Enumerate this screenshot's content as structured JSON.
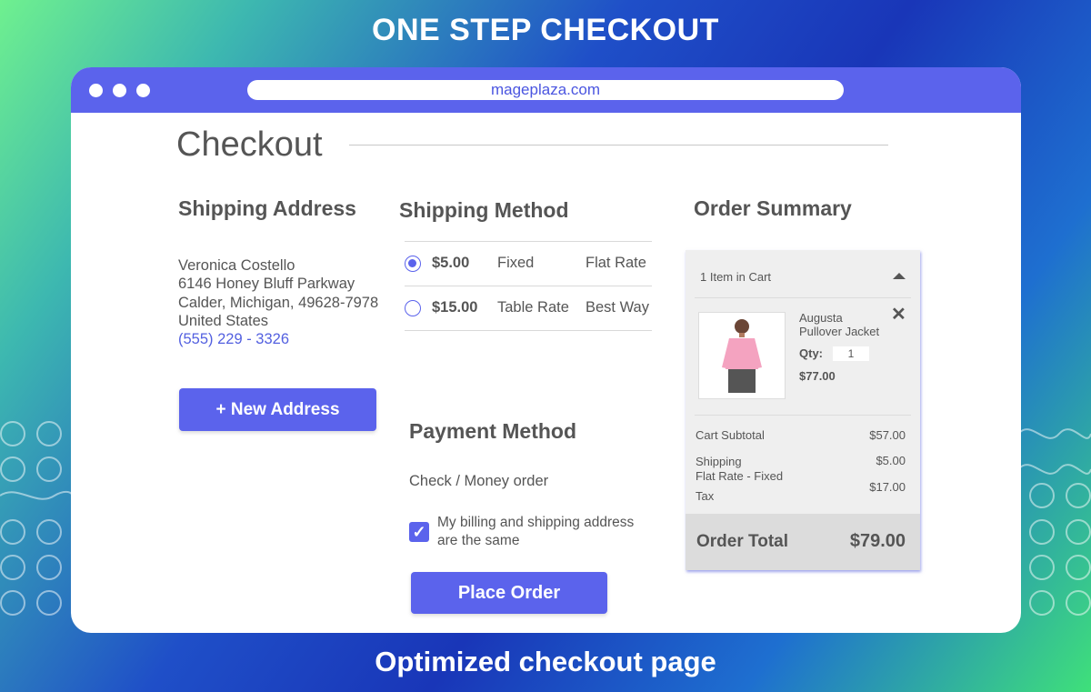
{
  "banner": {
    "headline": "ONE STEP CHECKOUT",
    "footline": "Optimized checkout page"
  },
  "browser": {
    "url": "mageplaza.com"
  },
  "checkout": {
    "title": "Checkout",
    "shipping_address": {
      "heading": "Shipping Address",
      "name": "Veronica Costello",
      "street": "6146 Honey Bluff Parkway",
      "city_line": "Calder, Michigan, 49628-7978",
      "country": "United States",
      "phone": "(555) 229 - 3326",
      "new_address_label": "+ New Address"
    },
    "shipping_method": {
      "heading": "Shipping Method",
      "options": [
        {
          "price": "$5.00",
          "method": "Fixed",
          "carrier": "Flat Rate",
          "selected": true
        },
        {
          "price": "$15.00",
          "method": "Table Rate",
          "carrier": "Best Way",
          "selected": false
        }
      ]
    },
    "payment_method": {
      "heading": "Payment Method",
      "option": "Check / Money order",
      "billing_same_label": "My billing and shipping address are the same",
      "billing_same_checked": true,
      "place_order_label": "Place Order"
    },
    "order_summary": {
      "heading": "Order Summary",
      "items_in_cart": "1 Item in Cart",
      "item": {
        "name_line1": "Augusta",
        "name_line2": "Pullover Jacket",
        "qty_label": "Qty:",
        "qty": "1",
        "price": "$77.00"
      },
      "cart_subtotal_label": "Cart Subtotal",
      "cart_subtotal": "$57.00",
      "shipping_label": "Shipping",
      "shipping_detail": "Flat  Rate - Fixed",
      "shipping_value": "$5.00",
      "tax_label": "Tax",
      "tax_value": "$17.00",
      "order_total_label": "Order Total",
      "order_total": "$79.00"
    }
  },
  "colors": {
    "accent": "#5b63ec",
    "text": "#555555"
  }
}
